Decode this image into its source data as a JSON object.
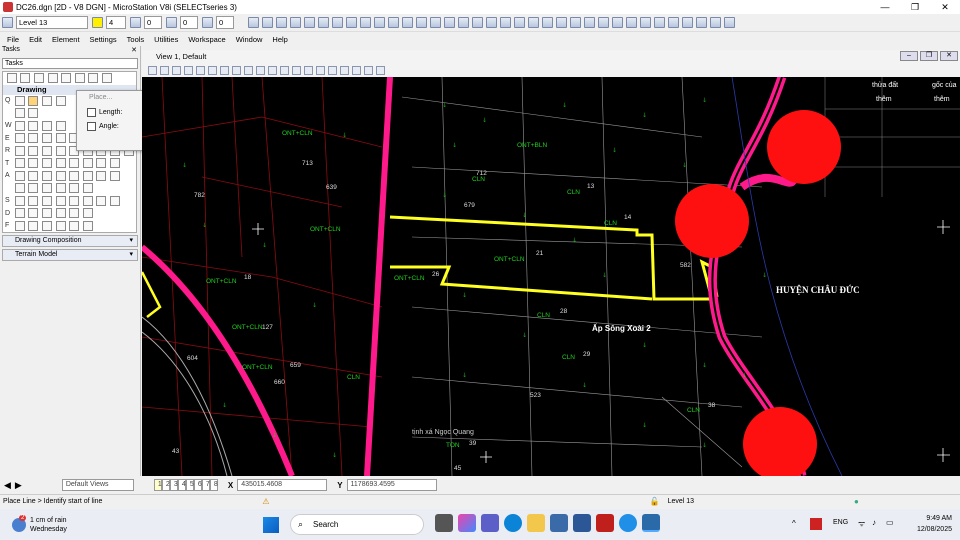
{
  "window": {
    "title": "DC26.dgn [2D - V8 DGN] - MicroStation V8i (SELECTseries 3)",
    "min": "—",
    "max": "❐",
    "close": "✕"
  },
  "toolbar": {
    "level": "Level 13",
    "color": "4",
    "weight": "0",
    "linestyle": "0"
  },
  "menu": [
    "File",
    "Edit",
    "Element",
    "Settings",
    "Tools",
    "Utilities",
    "Workspace",
    "Window",
    "Help"
  ],
  "tasks": {
    "title": "Tasks",
    "select": "Tasks",
    "drawing": "Drawing",
    "letters": [
      "Q",
      "W",
      "E",
      "R",
      "T",
      "A",
      "S",
      "D",
      "F"
    ],
    "sections": [
      "Drawing Composition",
      "Terrain Model"
    ]
  },
  "place": {
    "title": "Place...",
    "length_label": "Length:",
    "angle_label": "Angle:"
  },
  "view": {
    "title": "View 1, Default"
  },
  "map": {
    "labels": [
      {
        "t": "ONT+CLN",
        "c": "g"
      },
      {
        "t": "713",
        "c": "w"
      },
      {
        "t": "CLN",
        "c": "g"
      },
      {
        "t": "712",
        "c": "w"
      },
      {
        "t": "ONT+BLN",
        "c": "g"
      },
      {
        "t": "13",
        "c": "w"
      },
      {
        "t": "CLN",
        "c": "g"
      },
      {
        "t": "639",
        "c": "w"
      },
      {
        "t": "679",
        "c": "w"
      },
      {
        "t": "14",
        "c": "w"
      },
      {
        "t": "CLN",
        "c": "g"
      },
      {
        "t": "782",
        "c": "w"
      },
      {
        "t": "ONT+CLN",
        "c": "g"
      },
      {
        "t": "21",
        "c": "w"
      },
      {
        "t": "ONT+CLN",
        "c": "g"
      },
      {
        "t": "582",
        "c": "w"
      },
      {
        "t": "ONT+CLN",
        "c": "g"
      },
      {
        "t": "26",
        "c": "w"
      },
      {
        "t": "18",
        "c": "w"
      },
      {
        "t": "ONT+CLN",
        "c": "g"
      },
      {
        "t": "28",
        "c": "w"
      },
      {
        "t": "CLN",
        "c": "g"
      },
      {
        "t": "29",
        "c": "w"
      },
      {
        "t": "CLN",
        "c": "g"
      },
      {
        "t": "523",
        "c": "w"
      },
      {
        "t": "38",
        "c": "w"
      },
      {
        "t": "39",
        "c": "w"
      },
      {
        "t": "TON",
        "c": "g"
      },
      {
        "t": "CLN",
        "c": "g"
      },
      {
        "t": "ONT+CLN",
        "c": "g"
      },
      {
        "t": "ONT+CLN",
        "c": "g"
      },
      {
        "t": "659",
        "c": "w"
      },
      {
        "t": "660",
        "c": "w"
      },
      {
        "t": "604",
        "c": "w"
      },
      {
        "t": "43",
        "c": "w"
      },
      {
        "t": "CLN",
        "c": "g"
      },
      {
        "t": "45",
        "c": "w"
      },
      {
        "t": "127",
        "c": "w"
      }
    ],
    "region": "HUYỆN CHÂU ĐỨC",
    "hamlet": "Ấp Sông Xoài 2",
    "place2": "tịnh xá Ngọc Quang",
    "table": [
      "thửa đất",
      "thêm",
      "gốc của",
      "thêm"
    ]
  },
  "status": {
    "views": "Default Views",
    "pages": [
      "1",
      "2",
      "3",
      "4",
      "5",
      "6",
      "7",
      "8"
    ],
    "x_label": "X",
    "x": "435015.4608",
    "y_label": "Y",
    "y": "1178693.4595",
    "prompt": "Place Line > Identify start of line",
    "level": "Level 13"
  },
  "taskbar": {
    "weather": "1 cm of rain",
    "day": "Wednesday",
    "badge": "2",
    "search": "Search",
    "lang": "ENG",
    "time": "9:49 AM",
    "date": "12/08/2025"
  },
  "colors": {
    "green": "#20d020",
    "magenta": "#ff1a8c",
    "yellow": "#ffff20",
    "red": "#ff1010",
    "darkred": "#8a0c14"
  }
}
